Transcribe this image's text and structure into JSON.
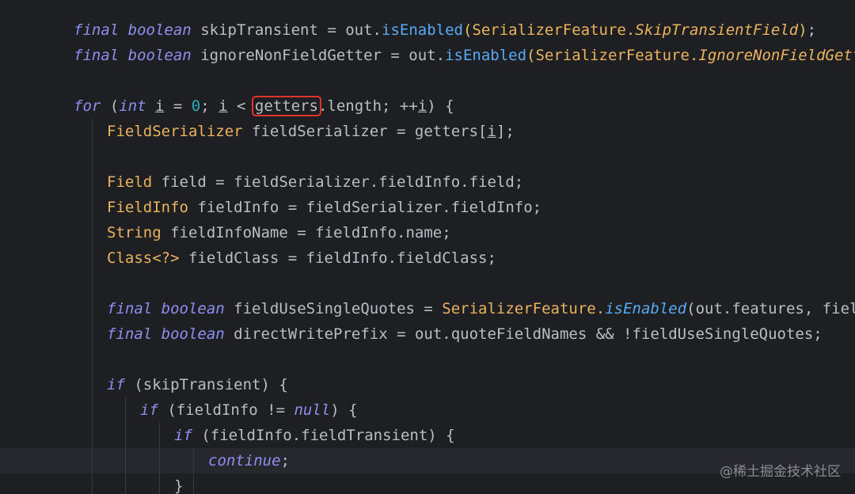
{
  "code": {
    "l1": {
      "k1": "final",
      "k2": "boolean",
      "v": "skipTransient",
      "eq": " = ",
      "obj": "out.",
      "m": "isEnabled",
      "po": "(",
      "cls": "SerializerFeature.",
      "cst": "SkipTransientField",
      "pc": ")",
      "end": ";"
    },
    "l2": {
      "k1": "final",
      "k2": "boolean",
      "v": "ignoreNonFieldGetter",
      "eq": " = ",
      "obj": "out.",
      "m": "isEnabled",
      "po": "(",
      "cls": "SerializerFeature.",
      "cst": "IgnoreNonFieldGetter",
      "pc": ")",
      "end": ";"
    },
    "l3": {
      "k1": "for",
      "p1": " (",
      "k2": "int",
      "i1": "i",
      "eq": " = ",
      "n": "0",
      "s1": "; ",
      "i2": "i",
      "lt": " < ",
      "g": "getters",
      "r": ".length; ++",
      "i3": "i",
      "e": ") {"
    },
    "l4": {
      "t": "FieldSerializer",
      "r": " fieldSerializer = getters[",
      "i": "i",
      "e": "];"
    },
    "l5": {
      "t": "Field",
      "r": " field = fieldSerializer.fieldInfo.field;"
    },
    "l6": {
      "t": "FieldInfo",
      "r": " fieldInfo = fieldSerializer.fieldInfo;"
    },
    "l7": {
      "t": "String",
      "r": " fieldInfoName = fieldInfo.name;"
    },
    "l8": {
      "t": "Class<?>",
      "r": " fieldClass = fieldInfo.fieldClass;"
    },
    "l9": {
      "k1": "final",
      "k2": "boolean",
      "v": " fieldUseSingleQuotes = ",
      "cls": "SerializerFeature.",
      "m": "isEnabled",
      "r": "(out.features, fieldInfo."
    },
    "l10": {
      "k1": "final",
      "k2": "boolean",
      "r": " directWritePrefix = out.quoteFieldNames && !fieldUseSingleQuotes;"
    },
    "l11": {
      "k": "if",
      "r": " (skipTransient) {"
    },
    "l12": {
      "k": "if",
      "r1": " (fieldInfo != ",
      "n": "null",
      "r2": ") {"
    },
    "l13": {
      "k": "if",
      "r": " (fieldInfo.fieldTransient) {"
    },
    "l14": {
      "k": "continue",
      "e": ";"
    },
    "l15": {
      "b": "}"
    }
  },
  "watermark": "@稀土掘金技术社区",
  "colors": {
    "background": "#1e1f22",
    "keyword": "#8f8ff0",
    "type": "#ecb35e",
    "method": "#57aaf7",
    "number": "#2aacb8",
    "highlight_box": "#e0332c"
  }
}
